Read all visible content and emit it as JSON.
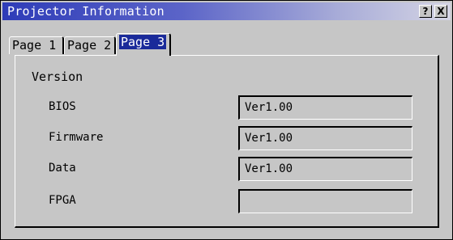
{
  "window": {
    "title": "Projector Information",
    "help_button": "?",
    "close_button": "X"
  },
  "tabs": [
    {
      "label": "Page 1",
      "selected": false
    },
    {
      "label": "Page 2",
      "selected": false
    },
    {
      "label": "Page 3",
      "selected": true
    }
  ],
  "panel": {
    "section_title": "Version",
    "rows": [
      {
        "label": "BIOS",
        "value": "Ver1.00"
      },
      {
        "label": "Firmware",
        "value": "Ver1.00"
      },
      {
        "label": "Data",
        "value": "Ver1.00"
      },
      {
        "label": "FPGA",
        "value": ""
      }
    ]
  }
}
